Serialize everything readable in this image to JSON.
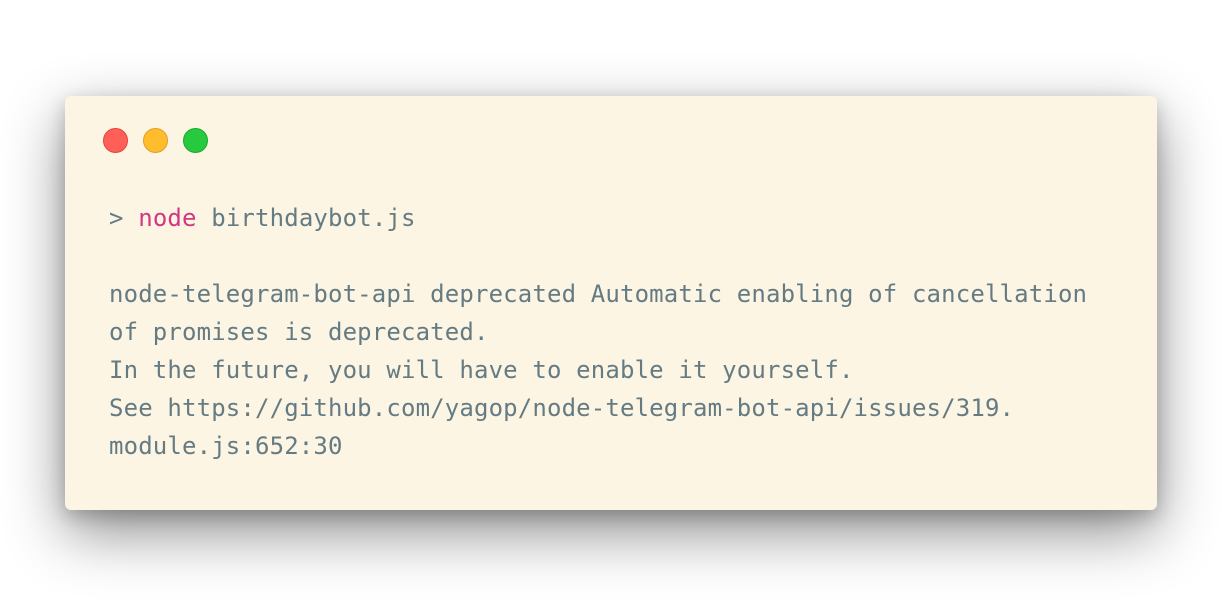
{
  "window": {
    "controls": [
      "close",
      "minimize",
      "maximize"
    ]
  },
  "terminal": {
    "prompt": ">",
    "command_keyword": "node",
    "command_arg": "birthdaybot.js",
    "output_lines": [
      "node-telegram-bot-api deprecated Automatic enabling of cancellation",
      "of promises is deprecated.",
      "In the future, you will have to enable it yourself.",
      "See https://github.com/yagop/node-telegram-bot-api/issues/319.",
      "module.js:652:30"
    ]
  },
  "colors": {
    "background": "#fcf5e3",
    "text": "#657b83",
    "keyword": "#d33682",
    "close": "#ff5f56",
    "minimize": "#ffbd2e",
    "maximize": "#27c93f"
  }
}
